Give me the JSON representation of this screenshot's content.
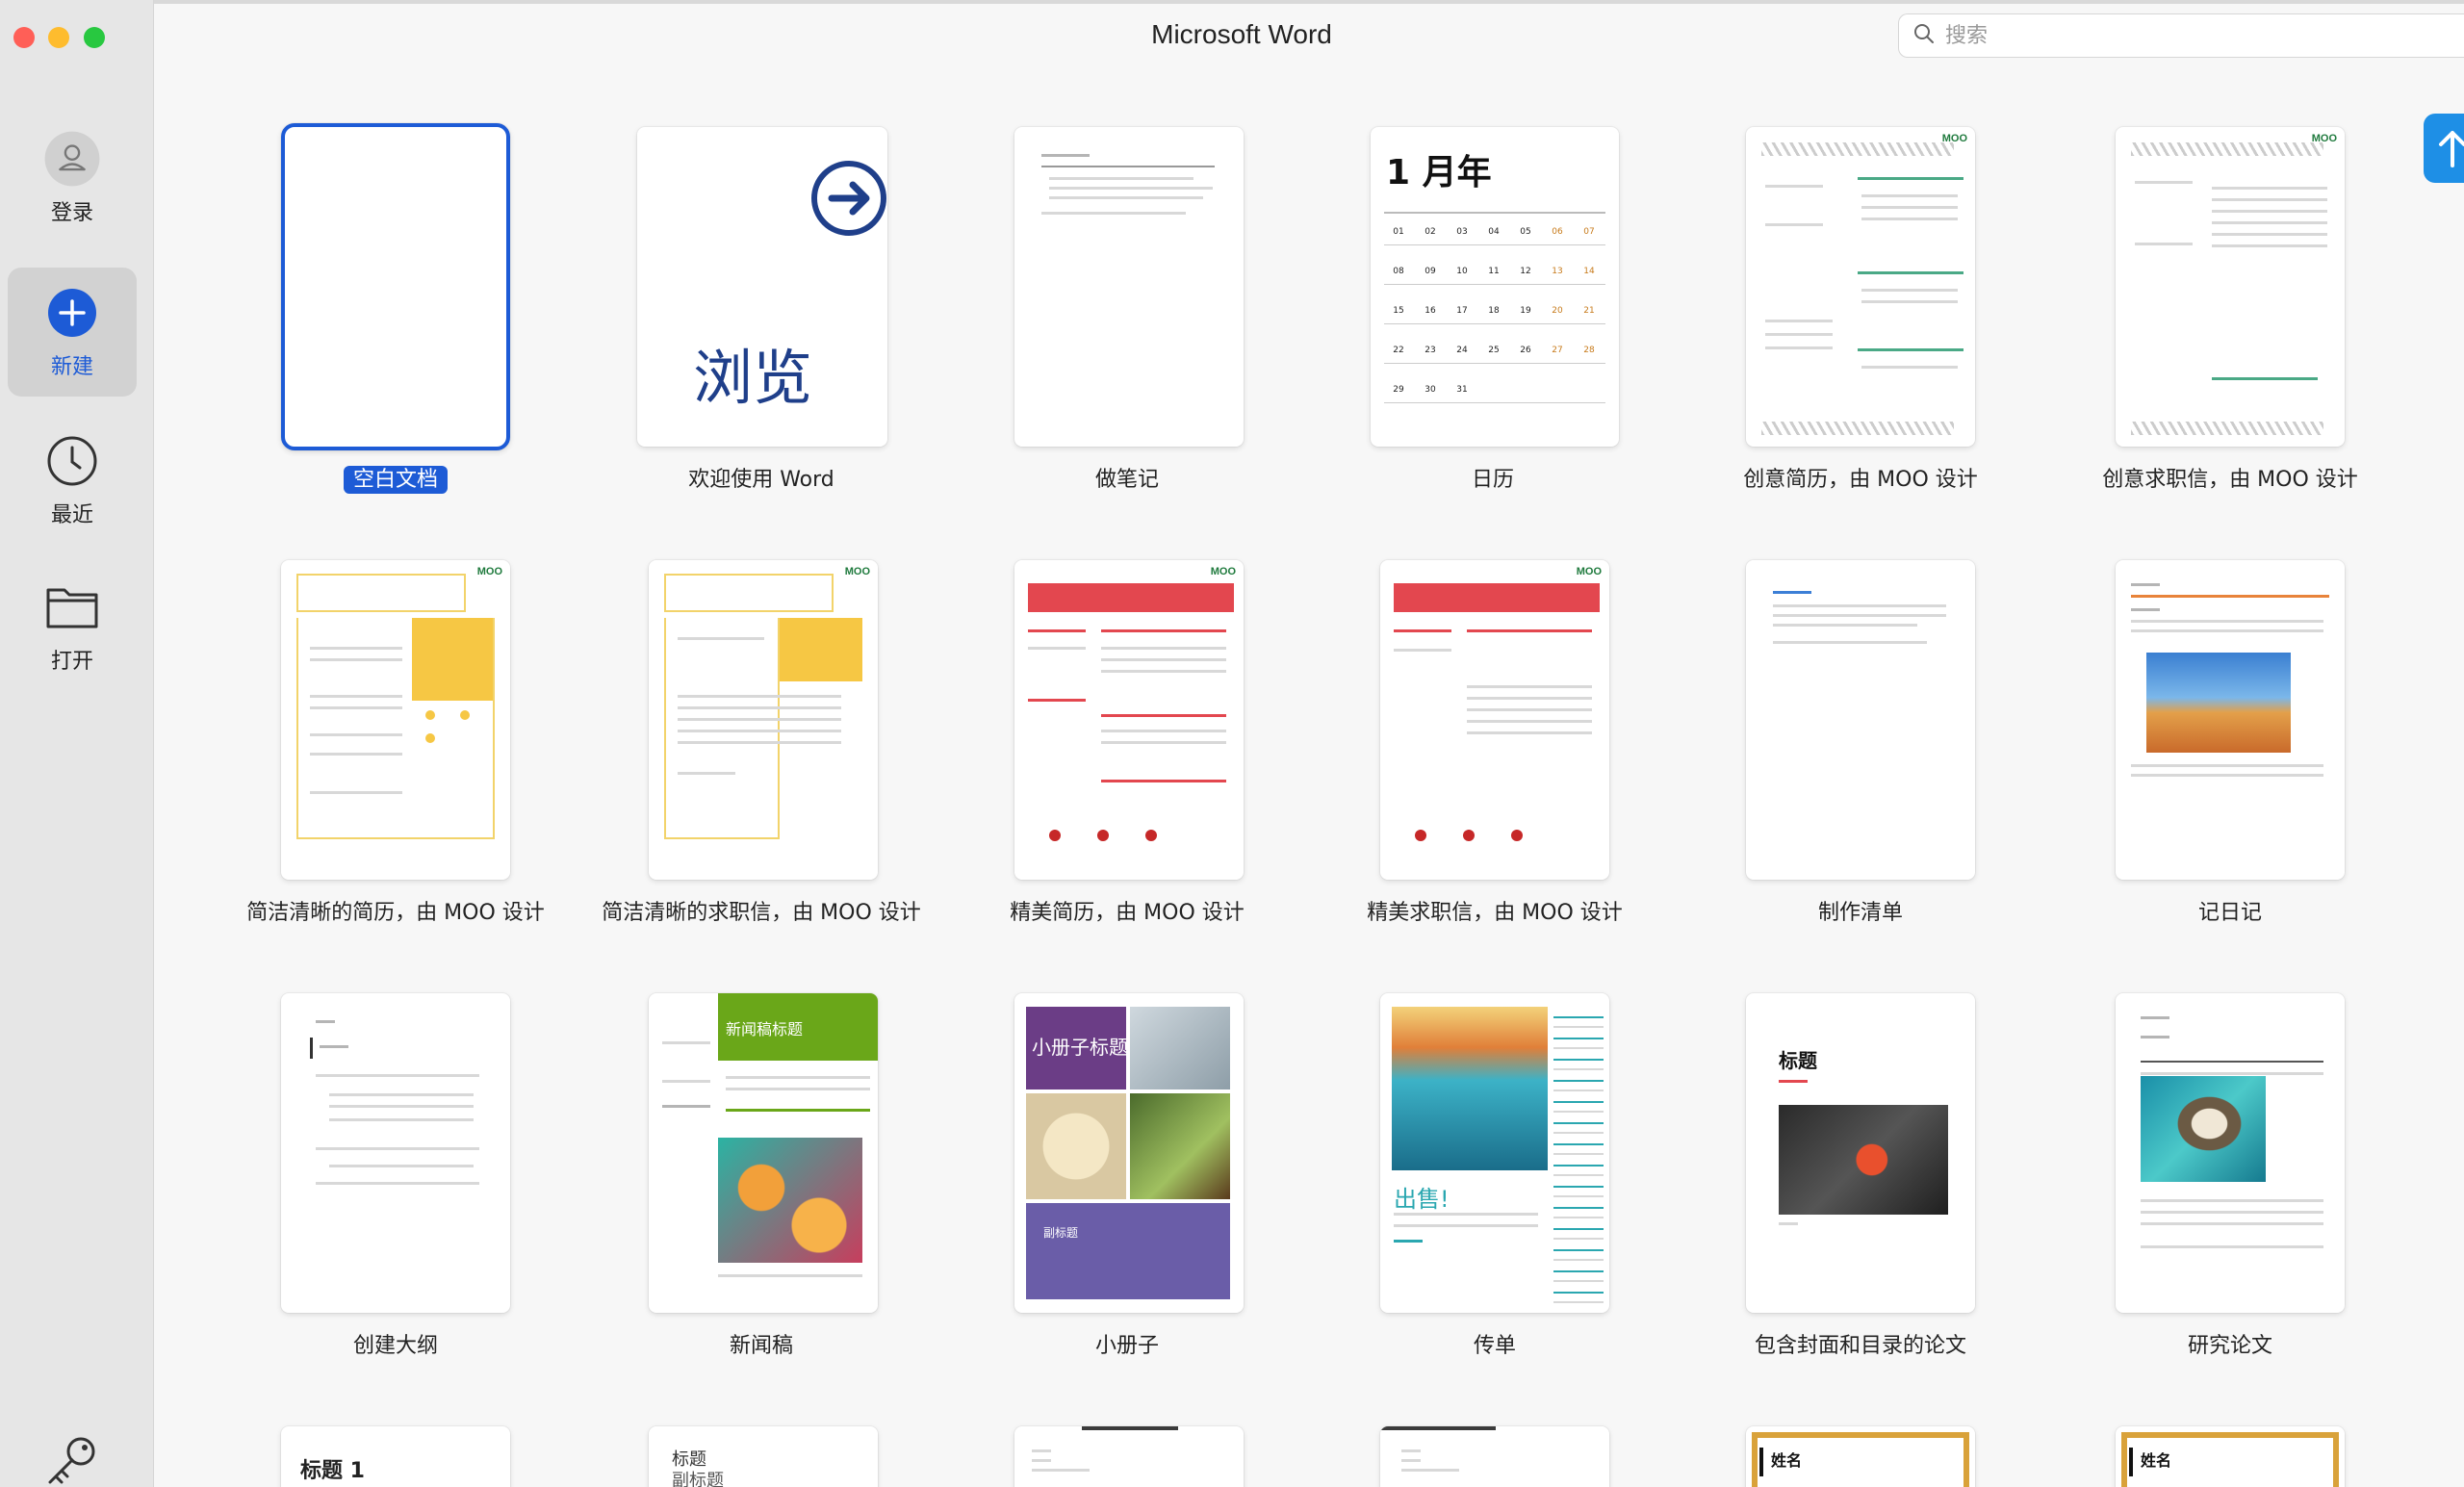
{
  "app": {
    "title": "Microsoft Word"
  },
  "search": {
    "placeholder": "搜索"
  },
  "sidebar": {
    "items": [
      {
        "label": "登录"
      },
      {
        "label": "新建"
      },
      {
        "label": "最近"
      },
      {
        "label": "打开"
      }
    ]
  },
  "templates": [
    {
      "label": "空白文档"
    },
    {
      "label": "欢迎使用 Word",
      "thumb_text": "浏览"
    },
    {
      "label": "做笔记"
    },
    {
      "label": "日历",
      "thumb_title": "1 月年"
    },
    {
      "label": "创意简历，由 MOO 设计"
    },
    {
      "label": "创意求职信，由 MOO 设计"
    },
    {
      "label": "简洁清晰的简历，由 MOO 设计"
    },
    {
      "label": "简洁清晰的求职信，由 MOO 设计"
    },
    {
      "label": "精美简历，由 MOO 设计"
    },
    {
      "label": "精美求职信，由 MOO 设计"
    },
    {
      "label": "制作清单"
    },
    {
      "label": "记日记"
    },
    {
      "label": "创建大纲"
    },
    {
      "label": "新闻稿",
      "thumb_title": "新闻稿标题"
    },
    {
      "label": "小册子",
      "thumb_title": "小册子标题",
      "thumb_sub": "副标题"
    },
    {
      "label": "传单",
      "thumb_title": "出售!"
    },
    {
      "label": "包含封面和目录的论文",
      "thumb_title": "标题"
    },
    {
      "label": "研究论文"
    }
  ],
  "partial_row": [
    {
      "thumb_title": "标题 1"
    },
    {
      "thumb_title": "标题",
      "thumb_sub": "副标题"
    },
    {
      "thumb_title": ""
    },
    {
      "thumb_title": ""
    },
    {
      "thumb_title": "姓名"
    },
    {
      "thumb_title": "姓名"
    }
  ],
  "calendar": {
    "weeks": [
      [
        "01",
        "02",
        "03",
        "04",
        "05",
        "06",
        "07"
      ],
      [
        "08",
        "09",
        "10",
        "11",
        "12",
        "13",
        "14"
      ],
      [
        "15",
        "16",
        "17",
        "18",
        "19",
        "20",
        "21"
      ],
      [
        "22",
        "23",
        "24",
        "25",
        "26",
        "27",
        "28"
      ],
      [
        "29",
        "30",
        "31",
        "",
        "",
        "",
        ""
      ]
    ]
  },
  "colors": {
    "accent": "#1d5bd6",
    "moo_green": "#1f7a3d",
    "red": "#e3474f",
    "yellow": "#f6c744",
    "purple": "#6a5da8",
    "green_banner": "#6aa719"
  }
}
